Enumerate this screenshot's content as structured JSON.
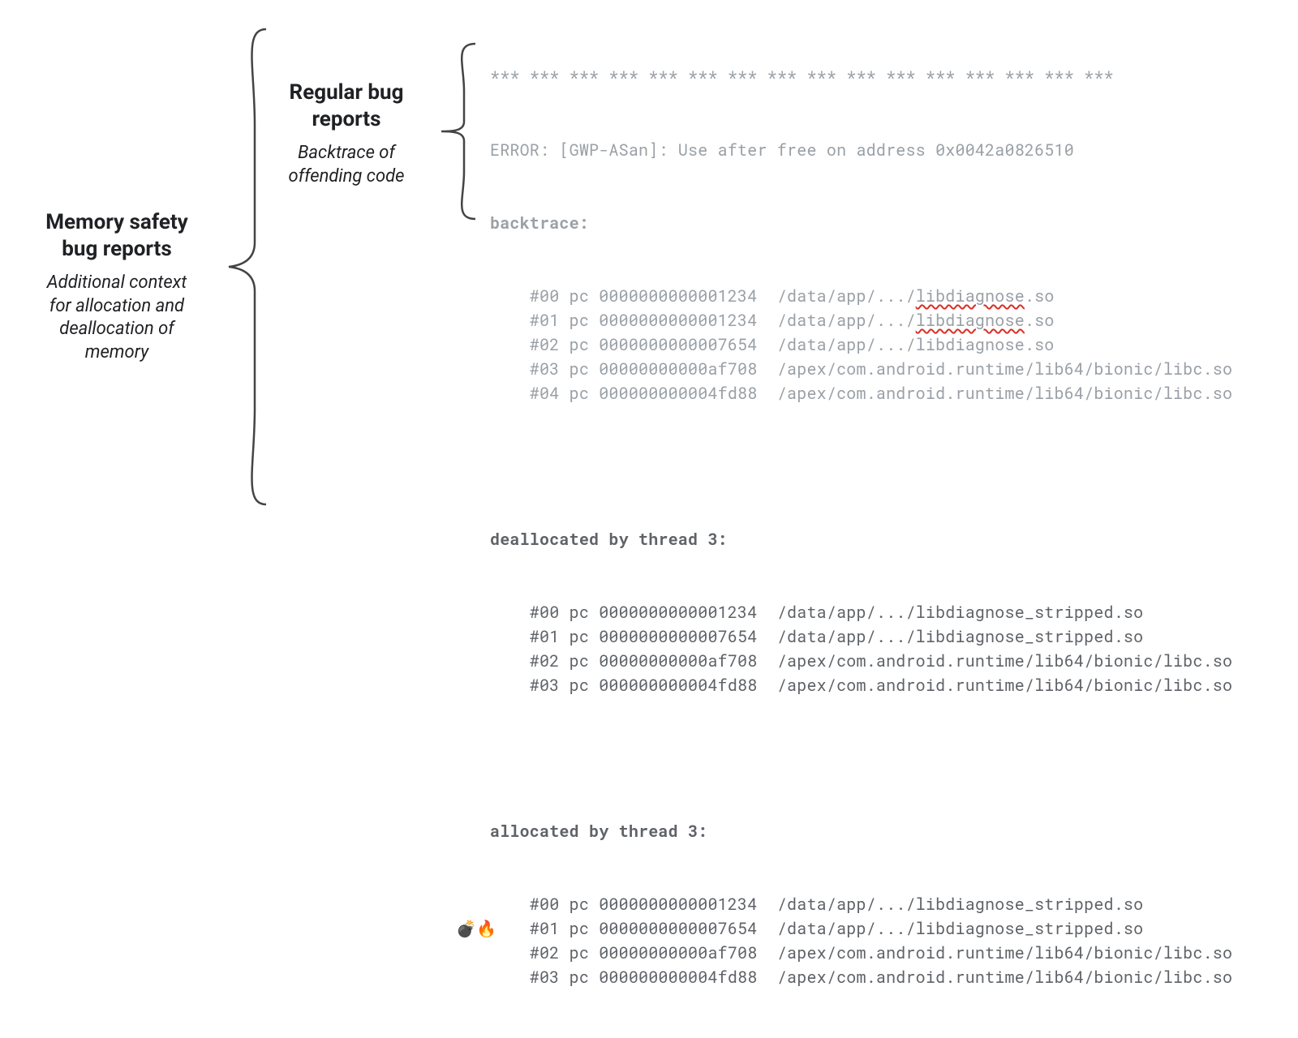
{
  "labels": {
    "memory": {
      "title": "Memory safety\nbug reports",
      "sub": "Additional context\nfor allocation and\ndeallocation of\nmemory"
    },
    "regular": {
      "title": "Regular bug\nreports",
      "sub": "Backtrace of\noffending code"
    }
  },
  "emoji_line": "💣🔥",
  "code": {
    "stars": "*** *** *** *** *** *** *** *** *** *** *** *** *** *** *** ***",
    "error": "ERROR: [GWP-ASan]: Use after free on address 0x0042a0826510",
    "backtrace_label": "backtrace:",
    "backtrace": [
      {
        "frame": "#00",
        "pre": "    #00 pc 0000000000001234  /data/app/.../",
        "lib": "libdiagnose",
        "ext": ".so",
        "squiggle": true
      },
      {
        "frame": "#01",
        "pre": "    #01 pc 0000000000001234  /data/app/.../",
        "lib": "libdiagnose",
        "ext": ".so",
        "squiggle": true
      },
      {
        "frame": "#02",
        "pre": "    #02 pc 0000000000007654  /data/app/.../libdiagnose.so"
      },
      {
        "frame": "#03",
        "pre": "    #03 pc 00000000000af708  /apex/com.android.runtime/lib64/bionic/libc.so"
      },
      {
        "frame": "#04",
        "pre": "    #04 pc 000000000004fd88  /apex/com.android.runtime/lib64/bionic/libc.so"
      }
    ],
    "dealloc_label": "deallocated by thread 3:",
    "dealloc": [
      "    #00 pc 0000000000001234  /data/app/.../libdiagnose_stripped.so",
      "    #01 pc 0000000000007654  /data/app/.../libdiagnose_stripped.so",
      "    #02 pc 00000000000af708  /apex/com.android.runtime/lib64/bionic/libc.so",
      "    #03 pc 000000000004fd88  /apex/com.android.runtime/lib64/bionic/libc.so"
    ],
    "alloc_label": "allocated by thread 3:",
    "alloc": [
      "    #00 pc 0000000000001234  /data/app/.../libdiagnose_stripped.so",
      "    #01 pc 0000000000007654  /data/app/.../libdiagnose_stripped.so",
      "    #02 pc 00000000000af708  /apex/com.android.runtime/lib64/bionic/libc.so",
      "    #03 pc 000000000004fd88  /apex/com.android.runtime/lib64/bionic/libc.so"
    ]
  }
}
